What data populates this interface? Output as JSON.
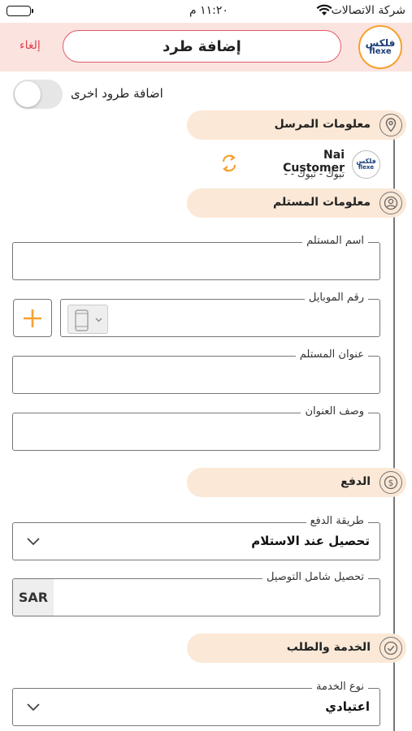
{
  "status_bar": {
    "carrier": "شركة الاتصالات",
    "time": "١١:٢٠ م"
  },
  "header": {
    "title": "إضافة طرد",
    "cancel": "إلغاء",
    "logo_ar": "فلكس",
    "logo_en": "flexe"
  },
  "toggle": {
    "label": "اضافة طرود اخرى",
    "on": false
  },
  "sender": {
    "section_label": "معلومات المرسل",
    "name": "Nai Customer",
    "city": "تبوك - تبوك - -"
  },
  "receiver": {
    "section_label": "معلومات المستلم",
    "name_label": "اسم المستلم",
    "mobile_label": "رقم الموبايل",
    "address_label": "عنوان المستلم",
    "address_desc_label": "وصف العنوان"
  },
  "payment": {
    "section_label": "الدفع",
    "method_label": "طريقة الدفع",
    "method_value": "تحصيل عند الاستلام",
    "cod_label": "تحصيل شامل التوصيل",
    "currency": "SAR"
  },
  "service": {
    "section_label": "الخدمة والطلب",
    "type_label": "نوع الخدمة",
    "type_value": "اعتيادي"
  },
  "colors": {
    "header_bg": "#fbe4df",
    "section_bg": "#fbe8d6",
    "accent_orange": "#f5a12f",
    "cancel_red": "#e04050"
  }
}
